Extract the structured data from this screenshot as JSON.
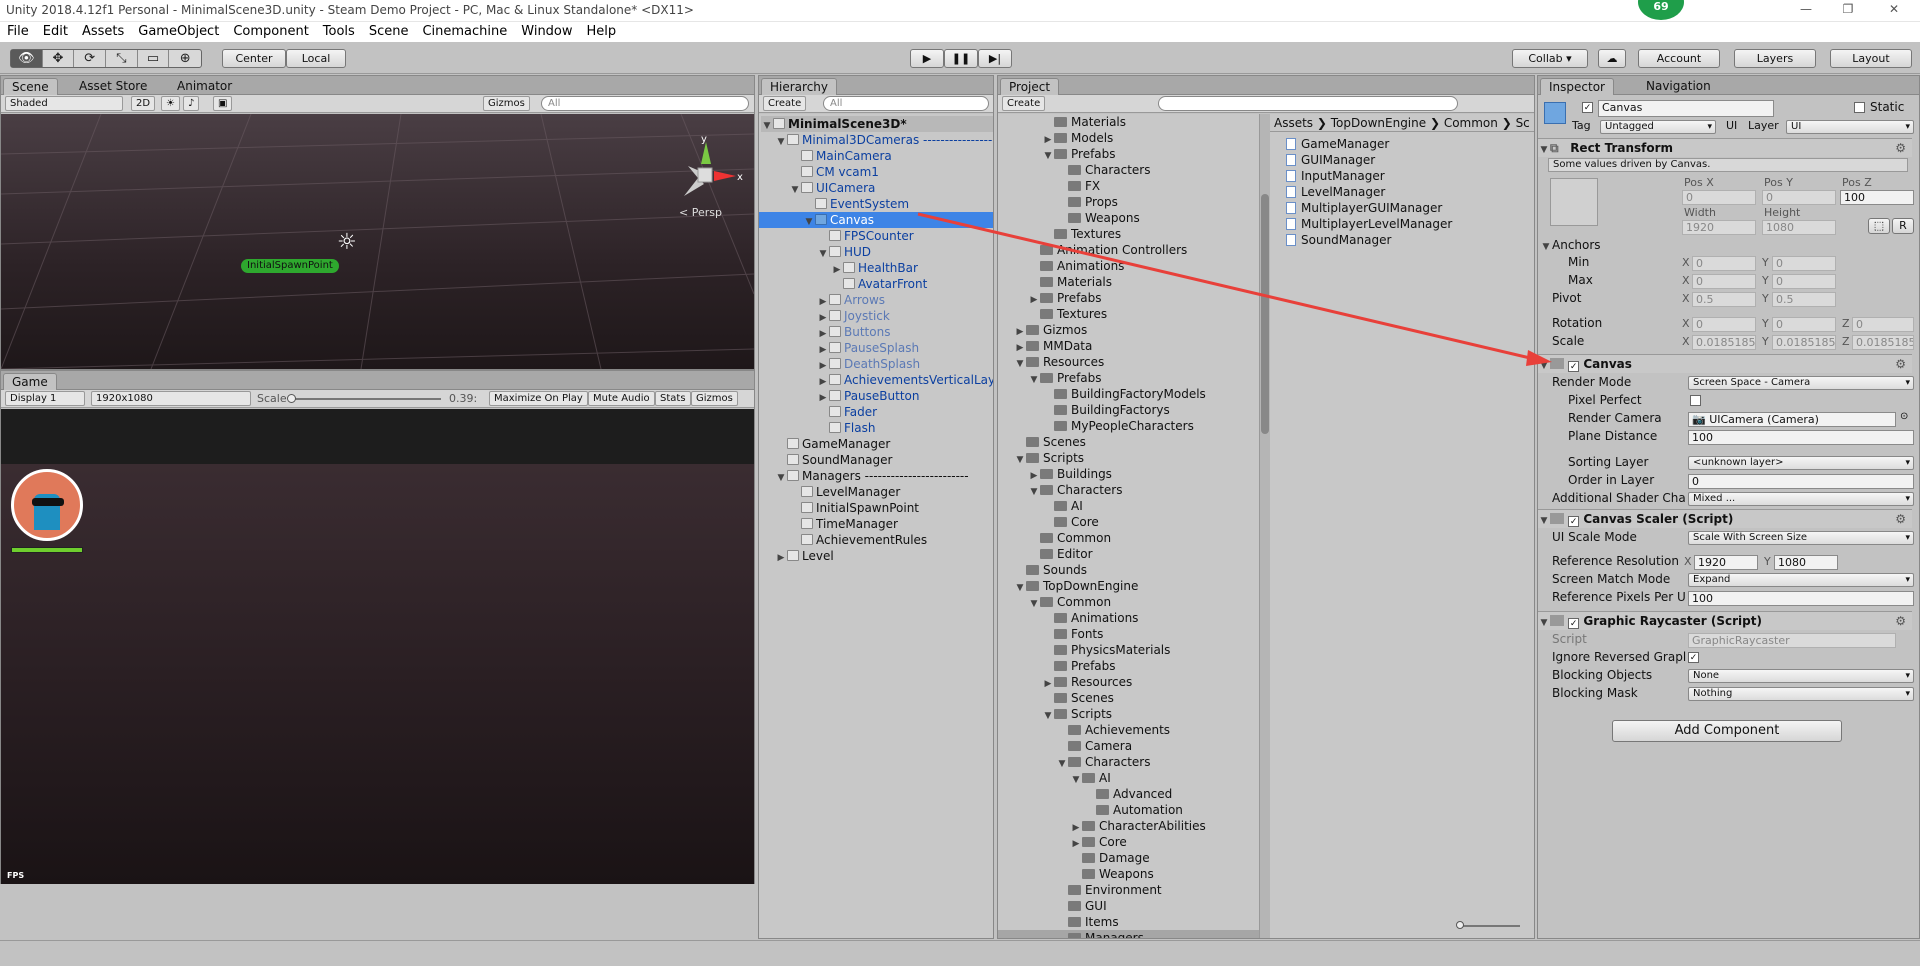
{
  "window": {
    "title": "Unity 2018.4.12f1 Personal - MinimalScene3D.unity - Steam Demo Project - PC, Mac & Linux Standalone* <DX11>",
    "badge": "69",
    "minimize": "—",
    "maximize": "❐",
    "close": "✕"
  },
  "menu": [
    "File",
    "Edit",
    "Assets",
    "GameObject",
    "Component",
    "Tools",
    "Scene",
    "Cinemachine",
    "Window",
    "Help"
  ],
  "toolbar": {
    "tools": [
      "👁",
      "✥",
      "⟳",
      "⤡",
      "▭",
      "⊕"
    ],
    "pivot": "Center",
    "space": "Local",
    "play": "▶",
    "pause": "❚❚",
    "step": "▶|",
    "collab": "Collab ▾",
    "cloud": "☁",
    "account": "Account",
    "layers": "Layers",
    "layout": "Layout"
  },
  "scene": {
    "tabs": [
      "Scene",
      "Asset Store",
      "Animator"
    ],
    "shading": "Shaded",
    "mode2d": "2D",
    "gizmos": "Gizmos",
    "search": "All",
    "persp": "< Persp",
    "spawn_label": "InitialSpawnPoint",
    "axis_y": "y",
    "axis_x": "x"
  },
  "game": {
    "tab": "Game",
    "display": "Display 1",
    "resolution": "1920x1080",
    "scale_label": "Scale",
    "scale_value": "0.39:",
    "maximize": "Maximize On Play",
    "mute": "Mute Audio",
    "stats": "Stats",
    "gizmos": "Gizmos",
    "fps": "FPS"
  },
  "hierarchy": {
    "tab": "Hierarchy",
    "create": "Create",
    "search": "All",
    "scene_name": "MinimalScene3D*",
    "items": [
      {
        "label": "Minimal3DCameras -----------------",
        "indent": 1,
        "fold": "▼",
        "style": "blue"
      },
      {
        "label": "MainCamera",
        "indent": 2,
        "fold": "",
        "style": "blue"
      },
      {
        "label": "CM vcam1",
        "indent": 2,
        "fold": "",
        "style": "blue"
      },
      {
        "label": "UICamera",
        "indent": 2,
        "fold": "▼",
        "style": "blue"
      },
      {
        "label": "EventSystem",
        "indent": 3,
        "fold": "",
        "style": "blue"
      },
      {
        "label": "Canvas",
        "indent": 3,
        "fold": "▼",
        "style": "selected"
      },
      {
        "label": "FPSCounter",
        "indent": 4,
        "fold": "",
        "style": "blue"
      },
      {
        "label": "HUD",
        "indent": 4,
        "fold": "▼",
        "style": "blue"
      },
      {
        "label": "HealthBar",
        "indent": 5,
        "fold": "▶",
        "style": "blue"
      },
      {
        "label": "AvatarFront",
        "indent": 5,
        "fold": "",
        "style": "blue"
      },
      {
        "label": "Arrows",
        "indent": 4,
        "fold": "▶",
        "style": "gray"
      },
      {
        "label": "Joystick",
        "indent": 4,
        "fold": "▶",
        "style": "gray"
      },
      {
        "label": "Buttons",
        "indent": 4,
        "fold": "▶",
        "style": "gray"
      },
      {
        "label": "PauseSplash",
        "indent": 4,
        "fold": "▶",
        "style": "gray"
      },
      {
        "label": "DeathSplash",
        "indent": 4,
        "fold": "▶",
        "style": "gray"
      },
      {
        "label": "AchievementsVerticalLayo",
        "indent": 4,
        "fold": "▶",
        "style": "blue"
      },
      {
        "label": "PauseButton",
        "indent": 4,
        "fold": "▶",
        "style": "blue"
      },
      {
        "label": "Fader",
        "indent": 4,
        "fold": "",
        "style": "blue"
      },
      {
        "label": "Flash",
        "indent": 4,
        "fold": "",
        "style": "blue"
      },
      {
        "label": "GameManager",
        "indent": 1,
        "fold": "",
        "style": "black"
      },
      {
        "label": "SoundManager",
        "indent": 1,
        "fold": "",
        "style": "black"
      },
      {
        "label": "Managers ------------------------",
        "indent": 1,
        "fold": "▼",
        "style": "black"
      },
      {
        "label": "LevelManager",
        "indent": 2,
        "fold": "",
        "style": "black"
      },
      {
        "label": "InitialSpawnPoint",
        "indent": 2,
        "fold": "",
        "style": "black"
      },
      {
        "label": "TimeManager",
        "indent": 2,
        "fold": "",
        "style": "black"
      },
      {
        "label": "AchievementRules",
        "indent": 2,
        "fold": "",
        "style": "black"
      },
      {
        "label": "Level",
        "indent": 1,
        "fold": "▶",
        "style": "black"
      }
    ]
  },
  "project": {
    "tab": "Project",
    "create": "Create",
    "tree": [
      {
        "label": "Materials",
        "indent": 3,
        "fold": ""
      },
      {
        "label": "Models",
        "indent": 3,
        "fold": "▶"
      },
      {
        "label": "Prefabs",
        "indent": 3,
        "fold": "▼"
      },
      {
        "label": "Characters",
        "indent": 4,
        "fold": ""
      },
      {
        "label": "FX",
        "indent": 4,
        "fold": ""
      },
      {
        "label": "Props",
        "indent": 4,
        "fold": ""
      },
      {
        "label": "Weapons",
        "indent": 4,
        "fold": ""
      },
      {
        "label": "Textures",
        "indent": 3,
        "fold": ""
      },
      {
        "label": "Animation Controllers",
        "indent": 2,
        "fold": ""
      },
      {
        "label": "Animations",
        "indent": 2,
        "fold": ""
      },
      {
        "label": "Materials",
        "indent": 2,
        "fold": ""
      },
      {
        "label": "Prefabs",
        "indent": 2,
        "fold": "▶"
      },
      {
        "label": "Textures",
        "indent": 2,
        "fold": ""
      },
      {
        "label": "Gizmos",
        "indent": 1,
        "fold": "▶"
      },
      {
        "label": "MMData",
        "indent": 1,
        "fold": "▶"
      },
      {
        "label": "Resources",
        "indent": 1,
        "fold": "▼"
      },
      {
        "label": "Prefabs",
        "indent": 2,
        "fold": "▼"
      },
      {
        "label": "BuildingFactoryModels",
        "indent": 3,
        "fold": ""
      },
      {
        "label": "BuildingFactorys",
        "indent": 3,
        "fold": ""
      },
      {
        "label": "MyPeopleCharacters",
        "indent": 3,
        "fold": ""
      },
      {
        "label": "Scenes",
        "indent": 1,
        "fold": ""
      },
      {
        "label": "Scripts",
        "indent": 1,
        "fold": "▼"
      },
      {
        "label": "Buildings",
        "indent": 2,
        "fold": "▶"
      },
      {
        "label": "Characters",
        "indent": 2,
        "fold": "▼"
      },
      {
        "label": "AI",
        "indent": 3,
        "fold": ""
      },
      {
        "label": "Core",
        "indent": 3,
        "fold": ""
      },
      {
        "label": "Common",
        "indent": 2,
        "fold": ""
      },
      {
        "label": "Editor",
        "indent": 2,
        "fold": ""
      },
      {
        "label": "Sounds",
        "indent": 1,
        "fold": ""
      },
      {
        "label": "TopDownEngine",
        "indent": 1,
        "fold": "▼"
      },
      {
        "label": "Common",
        "indent": 2,
        "fold": "▼"
      },
      {
        "label": "Animations",
        "indent": 3,
        "fold": ""
      },
      {
        "label": "Fonts",
        "indent": 3,
        "fold": ""
      },
      {
        "label": "PhysicsMaterials",
        "indent": 3,
        "fold": ""
      },
      {
        "label": "Prefabs",
        "indent": 3,
        "fold": ""
      },
      {
        "label": "Resources",
        "indent": 3,
        "fold": "▶"
      },
      {
        "label": "Scenes",
        "indent": 3,
        "fold": ""
      },
      {
        "label": "Scripts",
        "indent": 3,
        "fold": "▼"
      },
      {
        "label": "Achievements",
        "indent": 4,
        "fold": ""
      },
      {
        "label": "Camera",
        "indent": 4,
        "fold": ""
      },
      {
        "label": "Characters",
        "indent": 4,
        "fold": "▼"
      },
      {
        "label": "AI",
        "indent": 5,
        "fold": "▼"
      },
      {
        "label": "Advanced",
        "indent": 6,
        "fold": ""
      },
      {
        "label": "Automation",
        "indent": 6,
        "fold": ""
      },
      {
        "label": "CharacterAbilities",
        "indent": 5,
        "fold": "▶"
      },
      {
        "label": "Core",
        "indent": 5,
        "fold": "▶"
      },
      {
        "label": "Damage",
        "indent": 5,
        "fold": ""
      },
      {
        "label": "Weapons",
        "indent": 5,
        "fold": ""
      },
      {
        "label": "Environment",
        "indent": 4,
        "fold": ""
      },
      {
        "label": "GUI",
        "indent": 4,
        "fold": ""
      },
      {
        "label": "Items",
        "indent": 4,
        "fold": ""
      },
      {
        "label": "Managers",
        "indent": 4,
        "fold": ""
      }
    ],
    "breadcrumb": [
      "Assets",
      "TopDownEngine",
      "Common",
      "Sc"
    ],
    "files": [
      "GameManager",
      "GUIManager",
      "InputManager",
      "LevelManager",
      "MultiplayerGUIManager",
      "MultiplayerLevelManager",
      "SoundManager"
    ]
  },
  "inspector": {
    "tabs": [
      "Inspector",
      "Navigation"
    ],
    "object_name": "Canvas",
    "static_label": "Static",
    "tag_label": "Tag",
    "tag_value": "Untagged",
    "layer_label": "Layer",
    "layer_value": "UI",
    "rect_transform": {
      "title": "Rect Transform",
      "note": "Some values driven by Canvas.",
      "pos_x_label": "Pos X",
      "pos_y_label": "Pos Y",
      "pos_z_label": "Pos Z",
      "pos_x": "0",
      "pos_y": "0",
      "pos_z": "100",
      "width_label": "Width",
      "height_label": "Height",
      "width": "1920",
      "height": "1080",
      "anchors_label": "Anchors",
      "min_label": "Min",
      "min_x": "0",
      "min_y": "0",
      "max_label": "Max",
      "max_x": "0",
      "max_y": "0",
      "pivot_label": "Pivot",
      "pivot_x": "0.5",
      "pivot_y": "0.5",
      "rotation_label": "Rotation",
      "rot_x": "0",
      "rot_y": "0",
      "rot_z": "0",
      "scale_label": "Scale",
      "scale_x": "0.0185185",
      "scale_y": "0.0185185",
      "scale_z": "0.0185185",
      "r_button": "R"
    },
    "canvas": {
      "title": "Canvas",
      "render_mode_label": "Render Mode",
      "render_mode": "Screen Space - Camera",
      "pixel_perfect_label": "Pixel Perfect",
      "render_camera_label": "Render Camera",
      "render_camera": "UICamera (Camera)",
      "plane_distance_label": "Plane Distance",
      "plane_distance": "100",
      "sorting_layer_label": "Sorting Layer",
      "sorting_layer": "<unknown layer>",
      "order_label": "Order in Layer",
      "order": "0",
      "shader_label": "Additional Shader Chai",
      "shader": "Mixed ..."
    },
    "scaler": {
      "title": "Canvas Scaler (Script)",
      "ui_scale_label": "UI Scale Mode",
      "ui_scale": "Scale With Screen Size",
      "ref_res_label": "Reference Resolution",
      "ref_x": "1920",
      "ref_y": "1080",
      "match_label": "Screen Match Mode",
      "match": "Expand",
      "ppu_label": "Reference Pixels Per U",
      "ppu": "100"
    },
    "raycaster": {
      "title": "Graphic Raycaster (Script)",
      "script_label": "Script",
      "script": "GraphicRaycaster",
      "ignore_label": "Ignore Reversed Grapl",
      "blocking_objects_label": "Blocking Objects",
      "blocking_objects": "None",
      "blocking_mask_label": "Blocking Mask",
      "blocking_mask": "Nothing"
    },
    "add_component": "Add Component",
    "x": "X",
    "y": "Y",
    "z": "Z"
  },
  "colors": {
    "accent": "#3d84e6",
    "arrow": "#e8403a",
    "spawn": "#2ea82e"
  }
}
